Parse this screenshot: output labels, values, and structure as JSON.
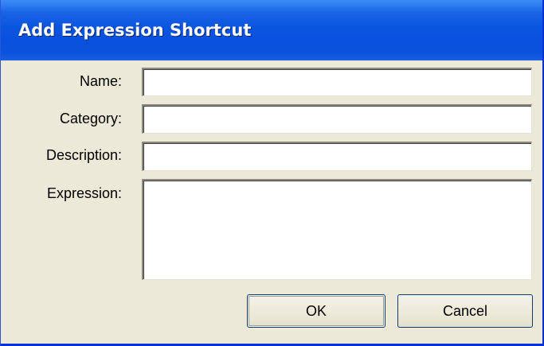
{
  "window": {
    "title": "Add Expression Shortcut"
  },
  "form": {
    "name_label": "Name:",
    "name_value": "",
    "category_label": "Category:",
    "category_value": "",
    "description_label": "Description:",
    "description_value": "",
    "expression_label": "Expression:",
    "expression_value": ""
  },
  "buttons": {
    "ok_label": "OK",
    "cancel_label": "Cancel"
  },
  "colors": {
    "titlebar": "#0a55df",
    "dialog_background": "#ece9d8",
    "button_border": "#003c74"
  }
}
